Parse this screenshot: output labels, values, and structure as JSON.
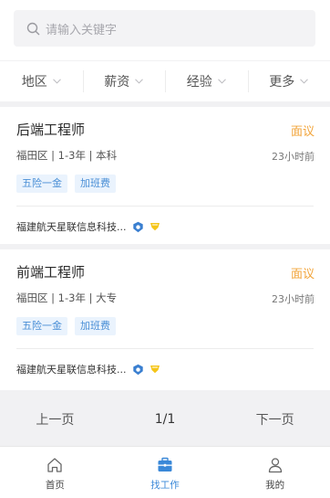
{
  "search": {
    "placeholder": "请输入关键字"
  },
  "filters": [
    {
      "label": "地区"
    },
    {
      "label": "薪资"
    },
    {
      "label": "经验"
    },
    {
      "label": "更多"
    }
  ],
  "jobs": [
    {
      "title": "后端工程师",
      "salary": "面议",
      "meta": "福田区 | 1-3年 | 本科",
      "time": "23小时前",
      "tags": [
        "五险一金",
        "加班费"
      ],
      "company": "福建航天星联信息科技..."
    },
    {
      "title": "前端工程师",
      "salary": "面议",
      "meta": "福田区 | 1-3年 | 大专",
      "time": "23小时前",
      "tags": [
        "五险一金",
        "加班费"
      ],
      "company": "福建航天星联信息科技..."
    }
  ],
  "pagination": {
    "prev": "上一页",
    "current": "1/1",
    "next": "下一页"
  },
  "tabbar": [
    {
      "label": "首页",
      "icon": "home-icon"
    },
    {
      "label": "找工作",
      "icon": "briefcase-icon",
      "active": true
    },
    {
      "label": "我的",
      "icon": "user-icon"
    }
  ],
  "colors": {
    "accent": "#3a88d8",
    "salary": "#f2a43a",
    "tag_text": "#4a8fd6",
    "tag_bg": "#eaf3fd"
  }
}
